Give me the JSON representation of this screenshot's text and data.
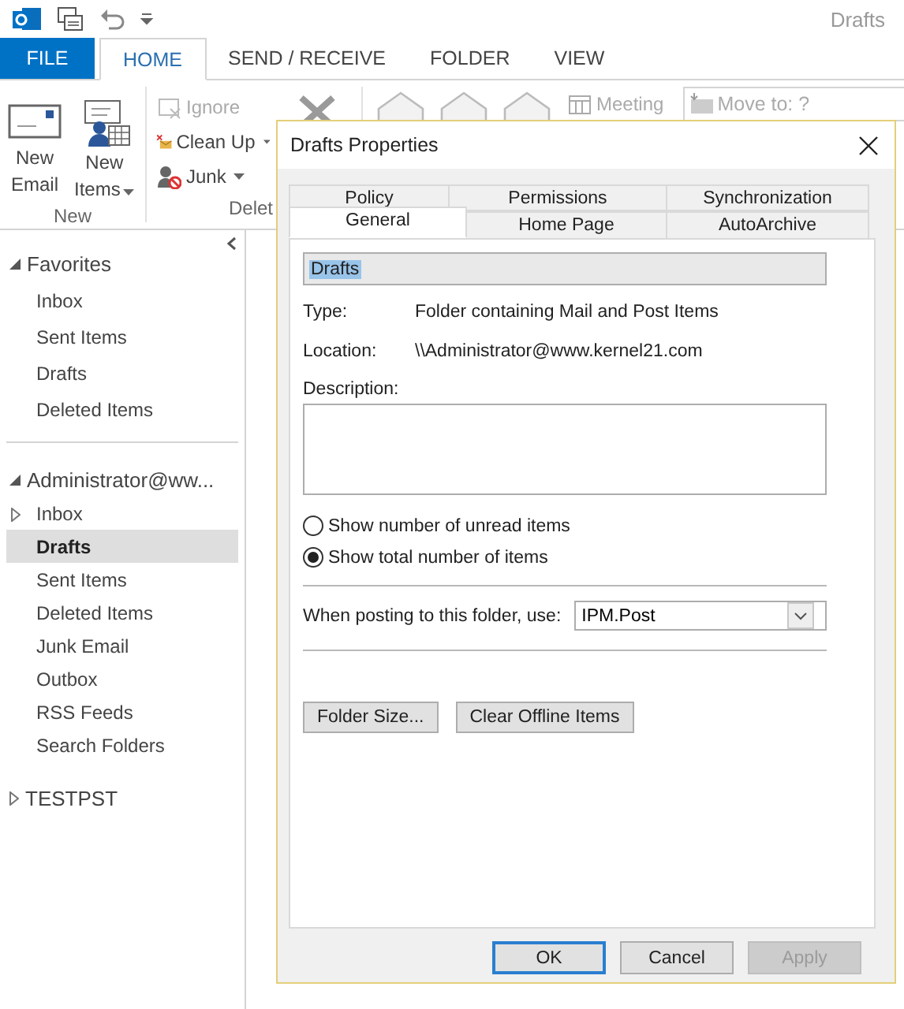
{
  "app": {
    "title": "Drafts"
  },
  "ribbon_tabs": [
    {
      "label": "FILE",
      "kind": "file",
      "selected": false
    },
    {
      "label": "HOME",
      "kind": "tab",
      "selected": true
    },
    {
      "label": "SEND / RECEIVE",
      "kind": "tab",
      "selected": false
    },
    {
      "label": "FOLDER",
      "kind": "tab",
      "selected": false
    },
    {
      "label": "VIEW",
      "kind": "tab",
      "selected": false
    }
  ],
  "ribbon": {
    "new_group": {
      "label": "New",
      "buttons": [
        {
          "line1": "New",
          "line2": "Email",
          "dropdown": false
        },
        {
          "line1": "New",
          "line2": "Items",
          "dropdown": true
        }
      ]
    },
    "delete_group": {
      "label": "Delet",
      "buttons": [
        {
          "label": "Ignore",
          "disabled": true,
          "dropdown": false
        },
        {
          "label": "Clean Up",
          "disabled": false,
          "dropdown": true
        },
        {
          "label": "Junk",
          "disabled": false,
          "dropdown": true
        }
      ]
    },
    "respond_group": {
      "meeting": {
        "label": "Meeting",
        "disabled": true
      }
    },
    "quick_steps": {
      "item": {
        "label": "Move to: ?",
        "disabled": true
      }
    }
  },
  "nav": {
    "favorites": {
      "label": "Favorites",
      "expanded": true,
      "items": [
        {
          "label": "Inbox",
          "selected": false,
          "expander": false
        },
        {
          "label": "Sent Items",
          "selected": false,
          "expander": false
        },
        {
          "label": "Drafts",
          "selected": false,
          "expander": false
        },
        {
          "label": "Deleted Items",
          "selected": false,
          "expander": false
        }
      ]
    },
    "accounts": [
      {
        "label": "Administrator@ww...",
        "expanded": true,
        "items": [
          {
            "label": "Inbox",
            "selected": false,
            "expander": true
          },
          {
            "label": "Drafts",
            "selected": true,
            "expander": false
          },
          {
            "label": "Sent Items",
            "selected": false,
            "expander": false
          },
          {
            "label": "Deleted Items",
            "selected": false,
            "expander": false
          },
          {
            "label": "Junk Email",
            "selected": false,
            "expander": false
          },
          {
            "label": "Outbox",
            "selected": false,
            "expander": false
          },
          {
            "label": "RSS Feeds",
            "selected": false,
            "expander": false
          },
          {
            "label": "Search Folders",
            "selected": false,
            "expander": false
          }
        ]
      },
      {
        "label": "TESTPST",
        "expanded": false
      }
    ]
  },
  "dialog": {
    "title": "Drafts Properties",
    "tab_rows": [
      [
        {
          "label": "Policy",
          "selected": false
        },
        {
          "label": "Permissions",
          "selected": false
        },
        {
          "label": "Synchronization",
          "selected": false
        }
      ],
      [
        {
          "label": "General",
          "selected": true
        },
        {
          "label": "Home Page",
          "selected": false
        },
        {
          "label": "AutoArchive",
          "selected": false
        }
      ]
    ],
    "name_field": {
      "value": "Drafts",
      "text_selected": true
    },
    "info": [
      {
        "label": "Type:",
        "value": "Folder containing Mail and Post Items"
      },
      {
        "label": "Location:",
        "value": "\\\\Administrator@www.kernel21.com"
      }
    ],
    "description": {
      "label": "Description:"
    },
    "radios": [
      {
        "label": "Show number of unread items",
        "selected": false
      },
      {
        "label": "Show total number of items",
        "selected": true
      }
    ],
    "posting": {
      "label": "When posting to this folder, use:",
      "value": "IPM.Post"
    },
    "actions": [
      "Folder Size...",
      "Clear Offline Items"
    ],
    "footer": [
      {
        "label": "OK",
        "default": true,
        "disabled": false
      },
      {
        "label": "Cancel",
        "default": false,
        "disabled": false
      },
      {
        "label": "Apply",
        "default": false,
        "disabled": true
      }
    ]
  }
}
